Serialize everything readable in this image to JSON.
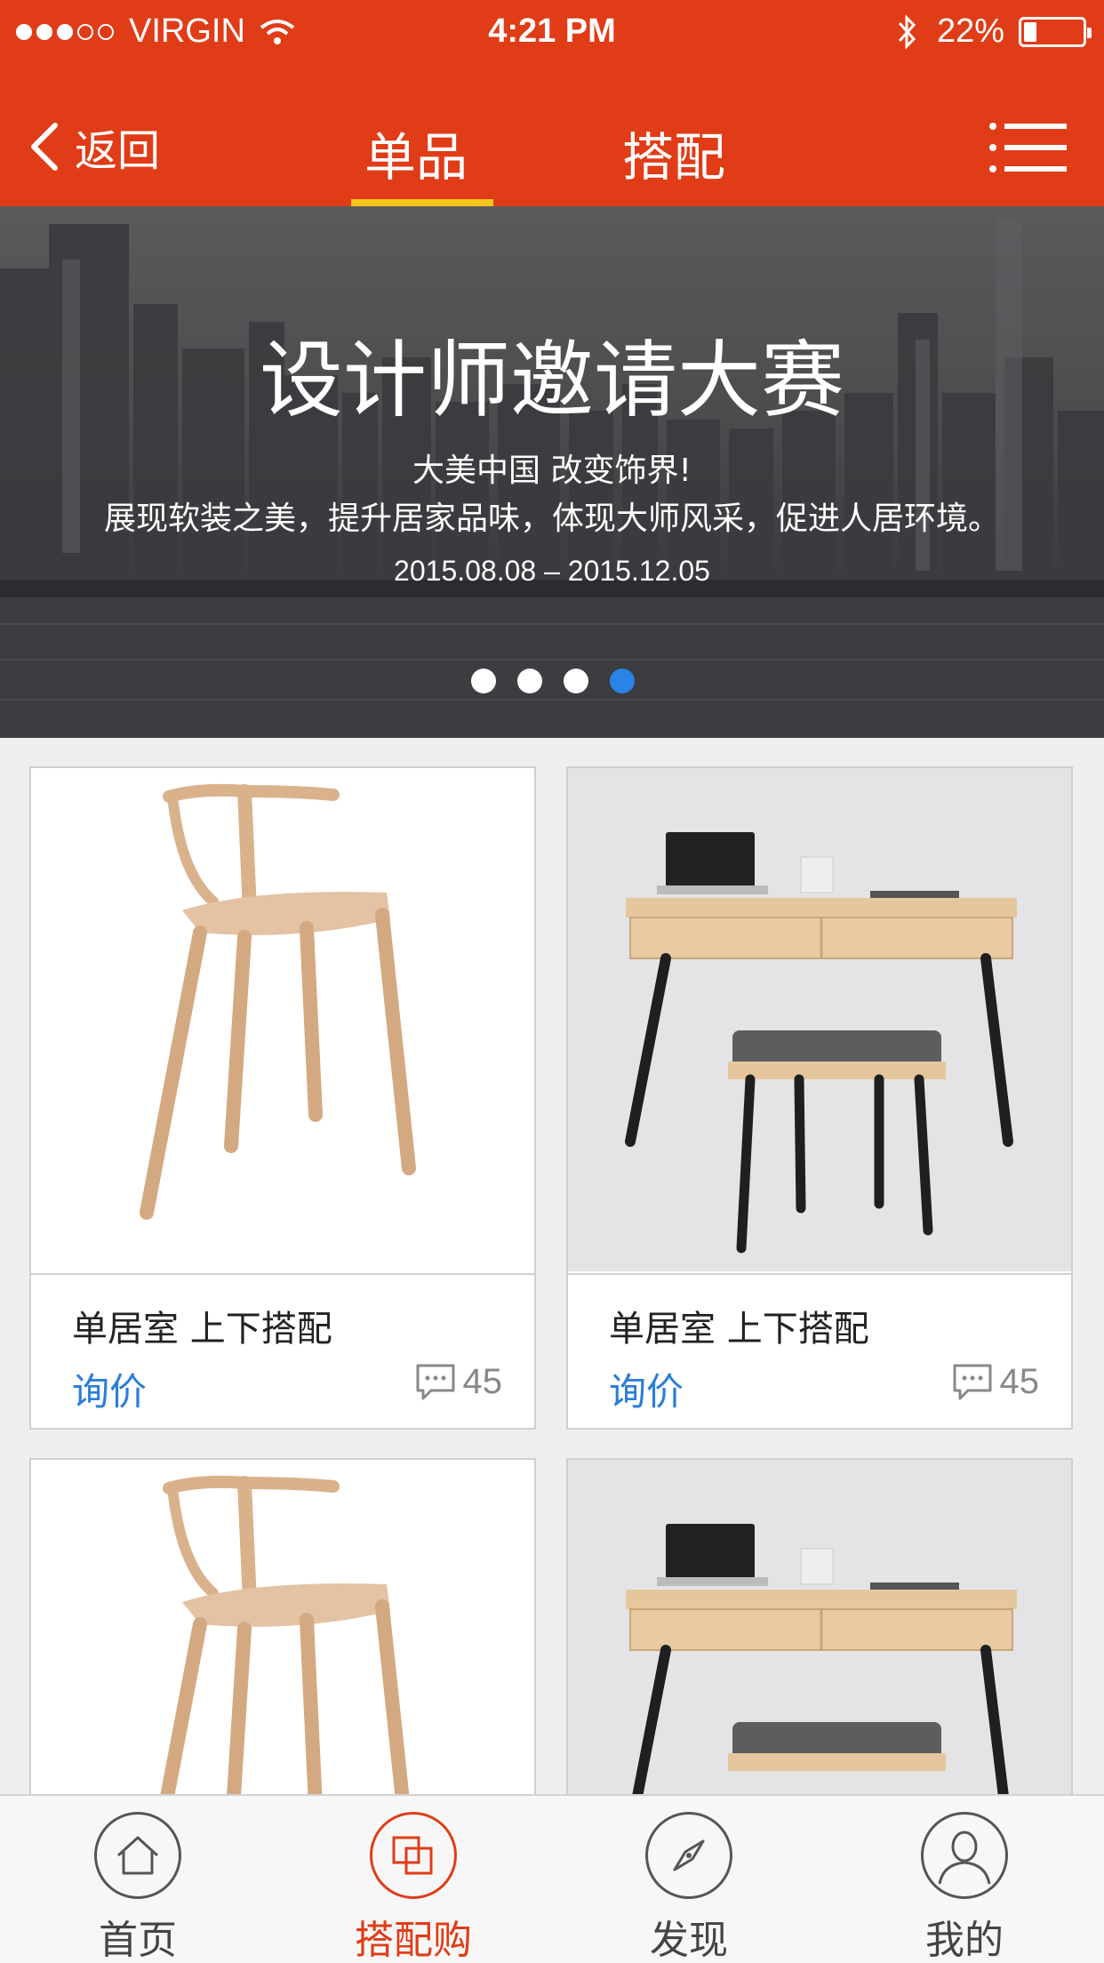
{
  "status_bar": {
    "carrier": "VIRGIN",
    "time": "4:21 PM",
    "battery_percent": "22%",
    "battery_level": 0.22,
    "signal_bars_filled": 3,
    "signal_bars_total": 5
  },
  "nav": {
    "back_label": "返回",
    "tabs": [
      {
        "label": "单品",
        "active": true
      },
      {
        "label": "搭配",
        "active": false
      }
    ],
    "menu_icon": "menu-icon",
    "accent_color": "#e03c17",
    "underline_color": "#f8c51c"
  },
  "banner": {
    "title": "设计师邀请大赛",
    "subtitle_line1": "大美中国 改变饰界!",
    "subtitle_line2": "展现软装之美，提升居家品味，体现大师风采，促进人居环境。",
    "date_range": "2015.08.08 – 2015.12.05",
    "page_count": 4,
    "active_page": 4
  },
  "products": [
    {
      "name": "单居室 上下搭配",
      "action": "询价",
      "comments": "45",
      "image": "bar-stool"
    },
    {
      "name": "单居室 上下搭配",
      "action": "询价",
      "comments": "45",
      "image": "desk-and-stool"
    },
    {
      "name": "",
      "action": "",
      "comments": "",
      "image": "bar-stool"
    },
    {
      "name": "",
      "action": "",
      "comments": "",
      "image": "desk-and-stool"
    }
  ],
  "tabbar": {
    "items": [
      {
        "label": "首页",
        "icon": "home-icon",
        "active": false
      },
      {
        "label": "搭配购",
        "icon": "match-buy-icon",
        "active": true
      },
      {
        "label": "发现",
        "icon": "compass-icon",
        "active": false
      },
      {
        "label": "我的",
        "icon": "profile-icon",
        "active": false
      }
    ]
  }
}
